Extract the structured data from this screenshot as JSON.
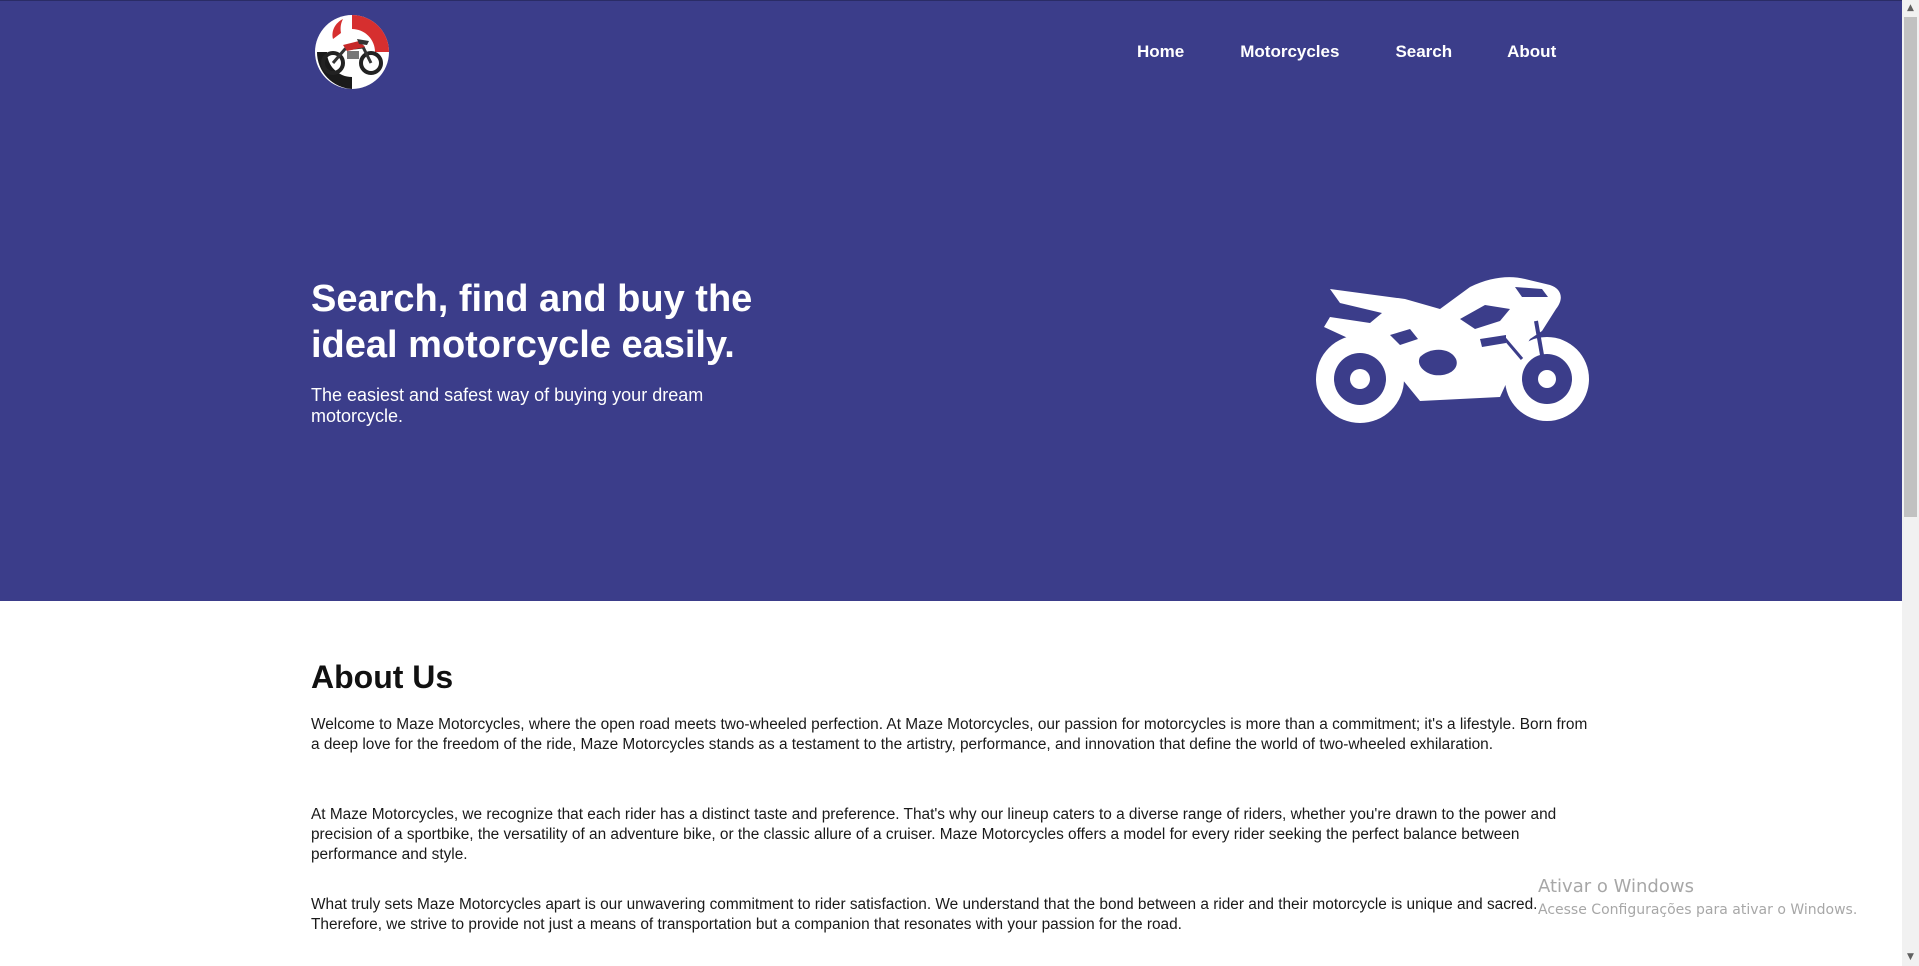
{
  "header": {
    "logo_icon": "motorcycle-logo-icon",
    "nav": [
      {
        "label": "Home"
      },
      {
        "label": "Motorcycles"
      },
      {
        "label": "Search"
      },
      {
        "label": "About"
      }
    ]
  },
  "hero": {
    "title": "Search, find and buy the ideal motorcycle easily.",
    "subtitle": "The easiest and safest way of buying your dream motorcycle.",
    "illustration_icon": "motorcycle-icon"
  },
  "about": {
    "title": "About Us",
    "paragraphs": [
      "Welcome to Maze Motorcycles, where the open road meets two-wheeled perfection. At Maze Motorcycles, our passion for motorcycles is more than a commitment; it's a lifestyle. Born from a deep love for the freedom of the ride, Maze Motorcycles stands as a testament to the artistry, performance, and innovation that define the world of two-wheeled exhilaration.",
      "At Maze Motorcycles, we recognize that each rider has a distinct taste and preference. That's why our lineup caters to a diverse range of riders, whether you're drawn to the power and precision of a sportbike, the versatility of an adventure bike, or the classic allure of a cruiser. Maze Motorcycles offers a model for every rider seeking the perfect balance between performance and style.",
      "What truly sets Maze Motorcycles apart is our unwavering commitment to rider satisfaction. We understand that the bond between a rider and their motorcycle is unique and sacred. Therefore, we strive to provide not just a means of transportation but a companion that resonates with your passion for the road."
    ]
  },
  "watermark": {
    "line1": "Ativar o Windows",
    "line2": "Acesse Configurações para ativar o Windows."
  },
  "colors": {
    "hero_bg": "#3b3d8a",
    "text_light": "#ffffff",
    "text_dark": "#111111"
  }
}
